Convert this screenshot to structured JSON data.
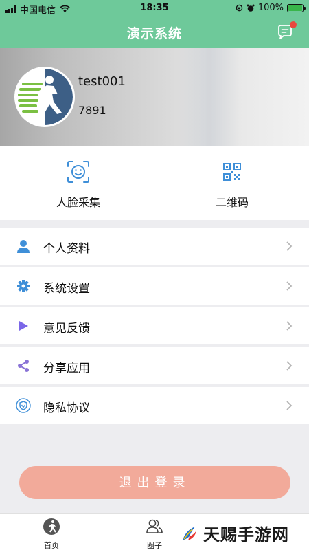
{
  "status_bar": {
    "carrier": "中国电信",
    "time": "18:35",
    "battery": "100%",
    "battery_level": 1.0
  },
  "nav": {
    "title": "演示系统",
    "message_icon": "chat-bubble-icon",
    "has_unread": true
  },
  "profile": {
    "username": "test001",
    "user_id": "7891",
    "avatar_icon": "runner-avatar"
  },
  "quick_actions": [
    {
      "label": "人脸采集",
      "icon": "face-scan-icon"
    },
    {
      "label": "二维码",
      "icon": "qr-code-icon"
    }
  ],
  "menu": [
    {
      "label": "个人资料",
      "icon": "person-icon"
    },
    {
      "label": "系统设置",
      "icon": "gear-icon"
    },
    {
      "label": "意见反馈",
      "icon": "play-icon"
    },
    {
      "label": "分享应用",
      "icon": "share-icon"
    },
    {
      "label": "隐私协议",
      "icon": "shield-icon"
    }
  ],
  "logout_label": "退出登录",
  "tabs": [
    {
      "label": "首页",
      "icon": "runner-icon"
    },
    {
      "label": "圈子",
      "icon": "group-icon"
    }
  ],
  "watermark": {
    "text": "天赐手游网"
  },
  "colors": {
    "primary": "#6ec99a",
    "logout": "#f2aa9a",
    "unread": "#e9473e",
    "icon_blue": "#3f8fd8",
    "icon_purple": "#7b67e8"
  }
}
